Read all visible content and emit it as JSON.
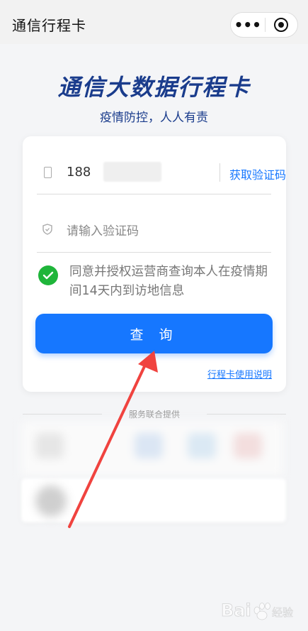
{
  "titlebar": {
    "title": "通信行程卡",
    "menu_icon": "more-dots-icon",
    "close_icon": "target-circle-icon"
  },
  "header": {
    "title": "通信大数据行程卡",
    "subtitle": "疫情防控，人人有责"
  },
  "form": {
    "phone_value": "188",
    "get_code_label": "获取验证码",
    "code_placeholder": "请输入验证码",
    "agree_text": "同意并授权运营商查询本人在疫情期间14天内到访地信息",
    "query_label": "查 询",
    "guide_link": "行程卡使用说明"
  },
  "footer": {
    "provider_text": "服务联合提供"
  },
  "colors": {
    "brand": "#1a3c8c",
    "accent": "#1677ff",
    "check": "#1fb53a",
    "arrow": "#f0433f"
  },
  "watermark": {
    "brand": "Bai",
    "suffix": "经验"
  }
}
